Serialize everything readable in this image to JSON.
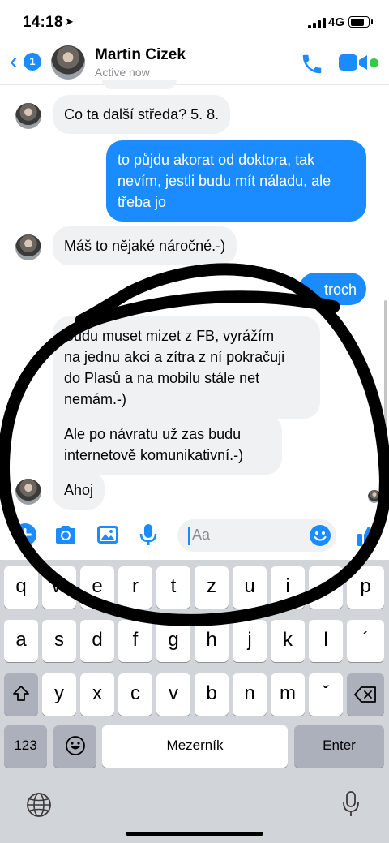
{
  "status_bar": {
    "time": "14:18",
    "network": "4G"
  },
  "header": {
    "back_badge": "1",
    "contact_name": "Martin Cizek",
    "contact_status": "Active now"
  },
  "messages": [
    {
      "from": "them",
      "text": "Co ta další středa? 5. 8."
    },
    {
      "from": "me",
      "lines": [
        "to půjdu akorat od doktora, tak",
        "nevím, jestli budu mít náladu, ale",
        "třeba jo"
      ]
    },
    {
      "from": "them",
      "text": "Máš to nějaké náročné.-)"
    },
    {
      "from": "me",
      "text": "troch"
    },
    {
      "from": "them",
      "lines": [
        "Budu muset mizet z FB, vyrážím",
        "na jednu akci a zítra z ní pokračuji",
        "do Plasů a na mobilu stále net",
        "nemám.-)"
      ]
    },
    {
      "from": "them",
      "lines": [
        "Ale po návratu už zas budu",
        "internetově komunikativní.-)"
      ]
    },
    {
      "from": "them",
      "text": "Ahoj"
    }
  ],
  "composer": {
    "placeholder": "Aa"
  },
  "keyboard": {
    "row1": [
      "q",
      "w",
      "e",
      "r",
      "t",
      "z",
      "u",
      "i",
      "o",
      "p"
    ],
    "row2": [
      "a",
      "s",
      "d",
      "f",
      "g",
      "h",
      "j",
      "k",
      "l",
      "´"
    ],
    "row3": [
      "y",
      "x",
      "c",
      "v",
      "b",
      "n",
      "m",
      "ˇ"
    ],
    "numbers_key": "123",
    "space_label": "Mezerník",
    "return_label": "Enter"
  },
  "colors": {
    "accent": "#1a8cff",
    "online": "#31cc46",
    "incoming_bubble": "#f0f1f3",
    "marker": "#000000"
  },
  "icons": [
    "location-arrow-icon",
    "signal-icon",
    "battery-icon",
    "back-chevron-icon",
    "phone-icon",
    "video-camera-icon",
    "plus-icon",
    "camera-icon",
    "gallery-icon",
    "microphone-icon",
    "emoji-icon",
    "thumbs-up-icon",
    "shift-icon",
    "backspace-icon",
    "emoji-keyboard-icon",
    "globe-icon",
    "dictation-icon"
  ]
}
